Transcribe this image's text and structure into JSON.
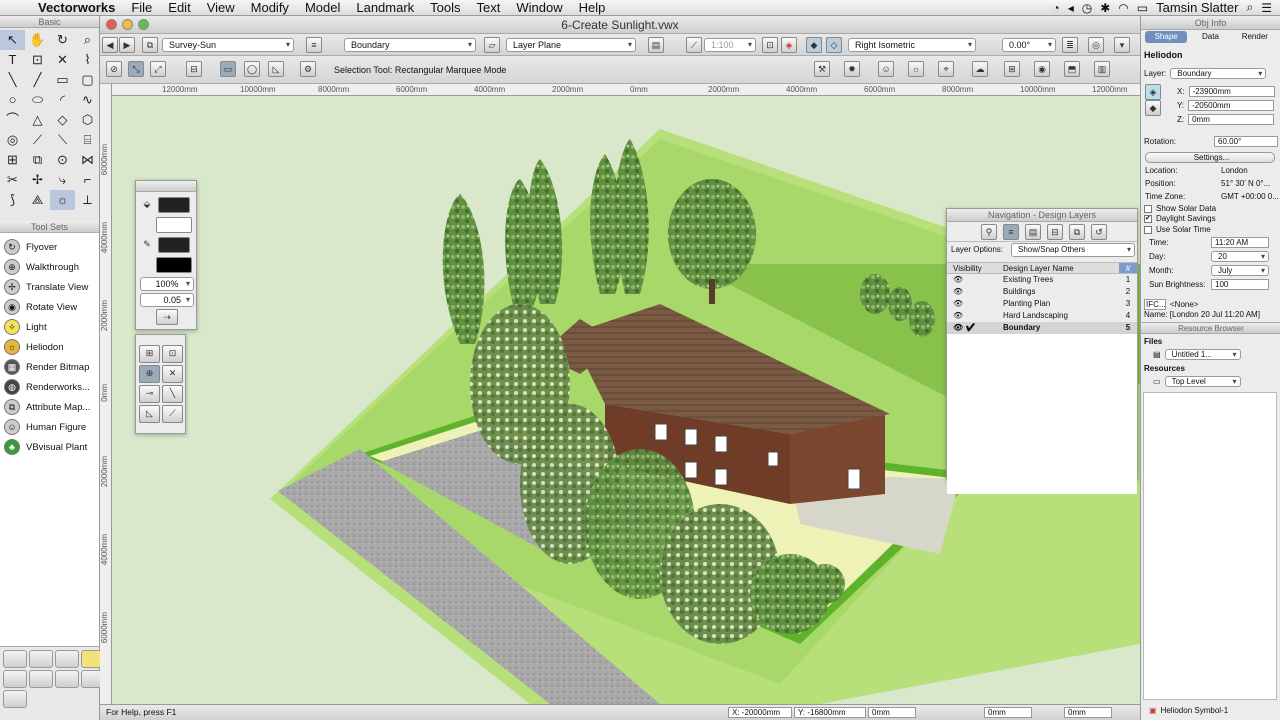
{
  "menubar": {
    "app": "Vectorworks",
    "items": [
      "File",
      "Edit",
      "View",
      "Modify",
      "Model",
      "Landmark",
      "Tools",
      "Text",
      "Window",
      "Help"
    ],
    "user": "Tamsin Slatter"
  },
  "window": {
    "title": "6-Create Sunlight.vwx"
  },
  "view_bar": {
    "class_value": "Survey-Sun",
    "layer_value": "Boundary",
    "layer_plane": "Layer Plane",
    "scale": "1:100",
    "view": "Right Isometric",
    "angle": "0.00°"
  },
  "mode_bar": {
    "text": "Selection Tool: Rectangular Marquee Mode"
  },
  "palettes": {
    "basic_title": "Basic",
    "toolsets_title": "Tool Sets",
    "toolset_items": [
      {
        "label": "Flyover",
        "icon": "flyover-icon"
      },
      {
        "label": "Walkthrough",
        "icon": "walkthrough-icon"
      },
      {
        "label": "Translate View",
        "icon": "translate-view-icon"
      },
      {
        "label": "Rotate View",
        "icon": "rotate-view-icon"
      },
      {
        "label": "Light",
        "icon": "light-icon"
      },
      {
        "label": "Heliodon",
        "icon": "heliodon-icon"
      },
      {
        "label": "Render Bitmap",
        "icon": "render-bitmap-icon"
      },
      {
        "label": "Renderworks...",
        "icon": "renderworks-icon"
      },
      {
        "label": "Attribute Map...",
        "icon": "attribute-map-icon"
      },
      {
        "label": "Human Figure",
        "icon": "human-figure-icon"
      },
      {
        "label": "VBvisual Plant",
        "icon": "vbvisual-plant-icon"
      }
    ]
  },
  "attributes": {
    "opacity": "100%",
    "line_weight": "0.05"
  },
  "rulers": {
    "top": [
      "12000mm",
      "10000mm",
      "8000mm",
      "6000mm",
      "4000mm",
      "2000mm",
      "0mm",
      "2000mm",
      "4000mm",
      "6000mm",
      "8000mm",
      "10000mm",
      "12000mm"
    ],
    "left": [
      "6000mm",
      "4000mm",
      "2000mm",
      "0mm",
      "2000mm",
      "4000mm",
      "6000mm"
    ]
  },
  "navigation": {
    "title": "Navigation - Design Layers",
    "layer_options_label": "Layer Options:",
    "layer_options_value": "Show/Snap Others",
    "col_visibility": "Visibility",
    "col_name": "Design Layer Name",
    "col_num": "#",
    "layers": [
      {
        "name": "Existing Trees",
        "num": "1"
      },
      {
        "name": "Buildings",
        "num": "2"
      },
      {
        "name": "Planting Plan",
        "num": "3"
      },
      {
        "name": "Hard Landscaping",
        "num": "4"
      },
      {
        "name": "Boundary",
        "num": "5"
      }
    ]
  },
  "obj_info": {
    "title": "Obj Info",
    "tabs": [
      "Shape",
      "Data",
      "Render"
    ],
    "object_name": "Heliodon",
    "layer_label": "Layer:",
    "layer_value": "Boundary",
    "x_label": "X:",
    "x_value": "-23900mm",
    "y_label": "Y:",
    "y_value": "-20500mm",
    "z_label": "Z:",
    "z_value": "0mm",
    "rotation_label": "Rotation:",
    "rotation_value": "60.00°",
    "settings_button": "Settings...",
    "location_label": "Location:",
    "location_value": "London",
    "position_label": "Position:",
    "position_value": "51° 30' N  0°...",
    "timezone_label": "Time Zone:",
    "timezone_value": "GMT +00:00 0...",
    "show_solar_data": "Show Solar Data",
    "daylight_savings": "Daylight Savings",
    "use_solar_time": "Use Solar Time",
    "time_label": "Time:",
    "time_value": "11:20 AM",
    "day_label": "Day:",
    "day_value": "20",
    "month_label": "Month:",
    "month_value": "July",
    "brightness_label": "Sun Brightness:",
    "brightness_value": "100",
    "ifc_label": "IFC...",
    "ifc_value": "<None>",
    "name_value": "Name: [London 20 Jul 11:20 AM]",
    "resource_browser": "Resource Browser",
    "files_label": "Files",
    "files_value": "Untitled 1...",
    "resources_label": "Resources",
    "resources_value": "Top Level",
    "footer_symbol": "Heliodon Symbol-1"
  },
  "status": {
    "help": "For Help, press F1",
    "x": "X: -20000mm",
    "y": "Y: -16800mm",
    "z": "0mm",
    "d1": "0mm",
    "d2": "0mm"
  }
}
